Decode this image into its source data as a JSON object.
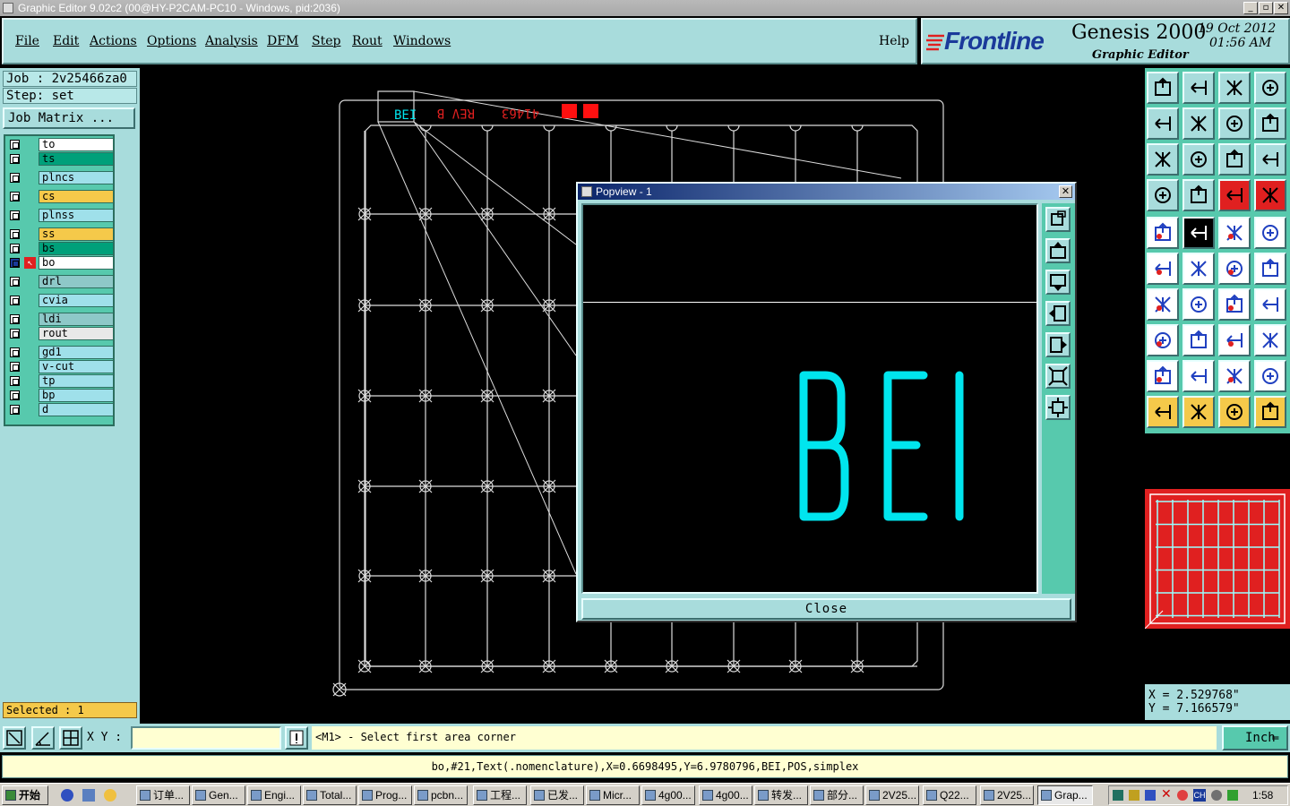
{
  "window": {
    "title": "Graphic Editor 9.02c2 (00@HY-P2CAM-PC10 - Windows, pid:2036)"
  },
  "menu": [
    "File",
    "Edit",
    "Actions",
    "Options",
    "Analysis",
    "DFM",
    "Step",
    "Rout",
    "Windows"
  ],
  "help": "Help",
  "brand": {
    "logo": "Frontline",
    "product": "Genesis 2000",
    "subtitle": "Graphic Editor",
    "date": "19 Oct 2012",
    "time": "01:56 AM"
  },
  "job": {
    "job_label": "Job : 2v25466za0",
    "step_label": "Step: set",
    "matrix_button": "Job Matrix ..."
  },
  "layers": [
    {
      "name": "to",
      "color": "#ffffff"
    },
    {
      "name": "ts",
      "color": "#00a07a"
    },
    {
      "name": "plncs",
      "color": "#9fe0ea"
    },
    {
      "name": "cs",
      "color": "#f5c94a"
    },
    {
      "name": "plnss",
      "color": "#9fe0ea"
    },
    {
      "name": "ss",
      "color": "#f5c94a"
    },
    {
      "name": "bs",
      "color": "#00a07a"
    },
    {
      "name": "bo",
      "color": "#ffffff",
      "active": true
    },
    {
      "name": "drl",
      "color": "#8ec8c8"
    },
    {
      "name": "cvia",
      "color": "#9fe0ea"
    },
    {
      "name": "ldi",
      "color": "#8ec8c8"
    },
    {
      "name": "rout",
      "color": "#e8e8e8"
    },
    {
      "name": "gd1",
      "color": "#9fe0ea"
    },
    {
      "name": "v-cut",
      "color": "#9fe0ea"
    },
    {
      "name": "tp",
      "color": "#9fe0ea"
    },
    {
      "name": "bp",
      "color": "#9fe0ea"
    },
    {
      "name": "d",
      "color": "#9fe0ea"
    }
  ],
  "selected": "Selected : 1",
  "canvas_texts": {
    "bei": "BEI",
    "rev": "REV B",
    "code": "41463"
  },
  "popup": {
    "title": "Popview - 1",
    "text": "BEI",
    "close": "Close"
  },
  "coords": {
    "x": "X = 2.529768\"",
    "y": "Y = 7.166579\""
  },
  "command": {
    "xy_label": "X Y :",
    "xy_value": "",
    "prompt": "<M1> - Select first area corner",
    "unit": "Inch"
  },
  "status": "bo,#21,Text(.nomenclature),X=0.6698495,Y=6.9780796,BEI,POS,simplex",
  "taskbar": {
    "start": "开始",
    "tasks": [
      "订单...",
      "Gen...",
      "Engi...",
      "Total...",
      "Prog...",
      "pcbn...",
      "工程...",
      "已发...",
      "Micr...",
      "4g00...",
      "4g00...",
      "转发...",
      "部分...",
      "2V25...",
      "Q22...",
      "2V25...",
      "Grap..."
    ],
    "clock": "1:58"
  },
  "colors": {
    "panel": "#a8dcdc",
    "panel_dark": "#57c9ad",
    "accent_cyan": "#00e5ee",
    "red": "#e02020"
  }
}
